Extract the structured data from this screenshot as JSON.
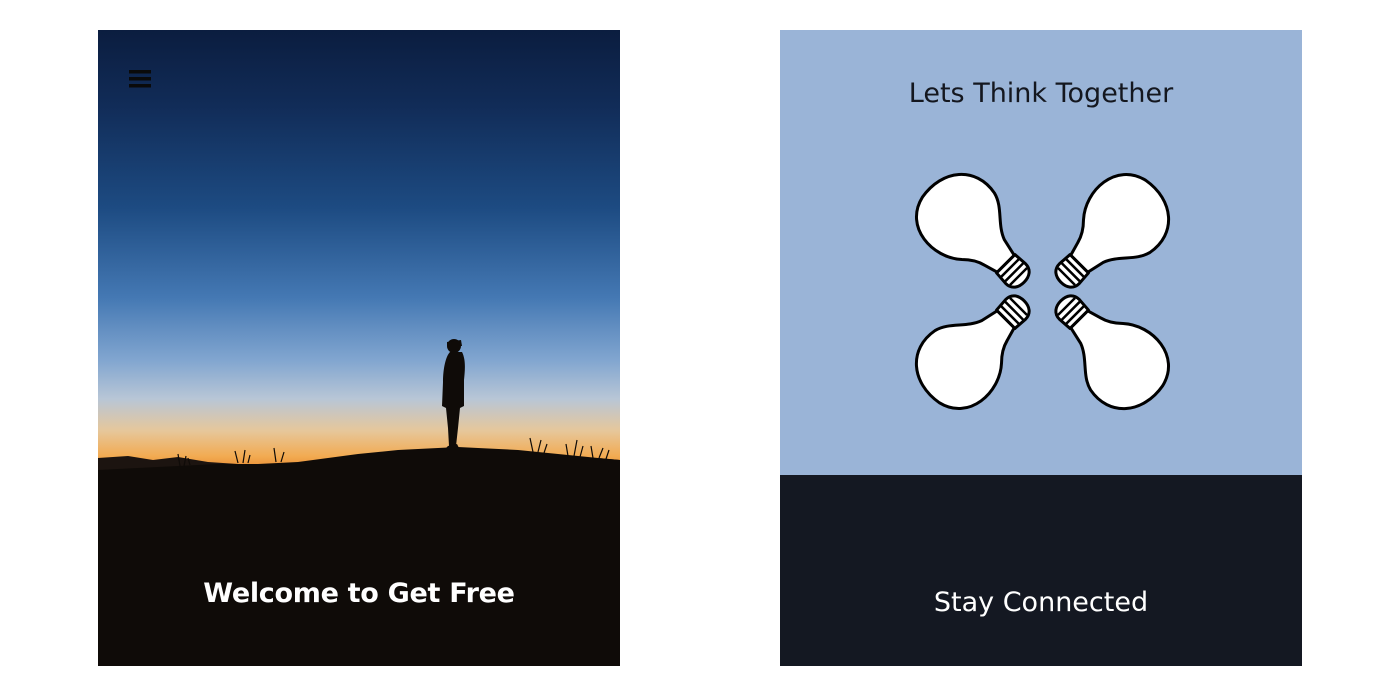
{
  "left_card": {
    "menu_icon": "hamburger-menu-icon",
    "title": "Welcome to Get Free"
  },
  "right_card": {
    "idea_section": {
      "title": "Lets Think Together",
      "illustration_icon": "four-lightbulbs-icon",
      "background_color": "#9ab4d7"
    },
    "connect_section": {
      "title": "Stay Connected",
      "background_color": "#141822"
    }
  }
}
